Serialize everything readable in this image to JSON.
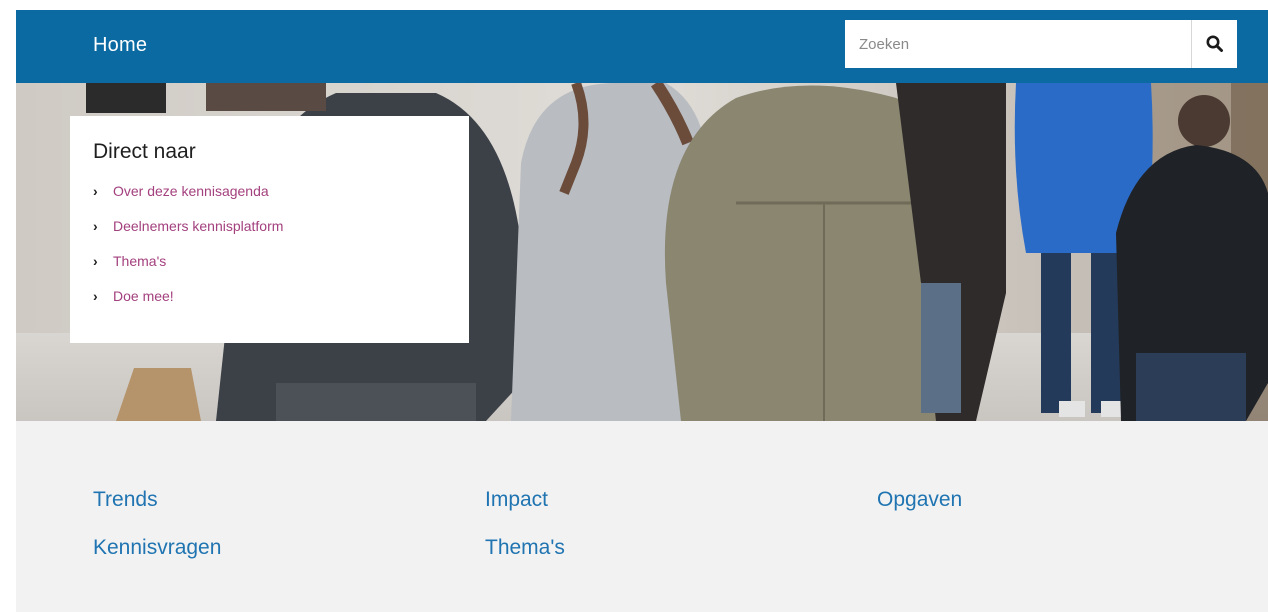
{
  "header": {
    "home_label": "Home",
    "search": {
      "placeholder": "Zoeken",
      "button_icon": "search-icon"
    }
  },
  "direct_naar": {
    "title": "Direct naar",
    "items": [
      {
        "label": "Over deze kennisagenda"
      },
      {
        "label": "Deelnemers kennisplatform"
      },
      {
        "label": "Thema's"
      },
      {
        "label": "Doe mee!"
      }
    ]
  },
  "categories": [
    {
      "label": "Trends"
    },
    {
      "label": "Impact"
    },
    {
      "label": "Opgaven"
    },
    {
      "label": "Kennisvragen"
    },
    {
      "label": "Thema's"
    }
  ],
  "colors": {
    "header_bg": "#0b6aa2",
    "link_purple": "#a3407e",
    "link_blue": "#1f74b1",
    "footer_bg": "#f2f2f2"
  }
}
